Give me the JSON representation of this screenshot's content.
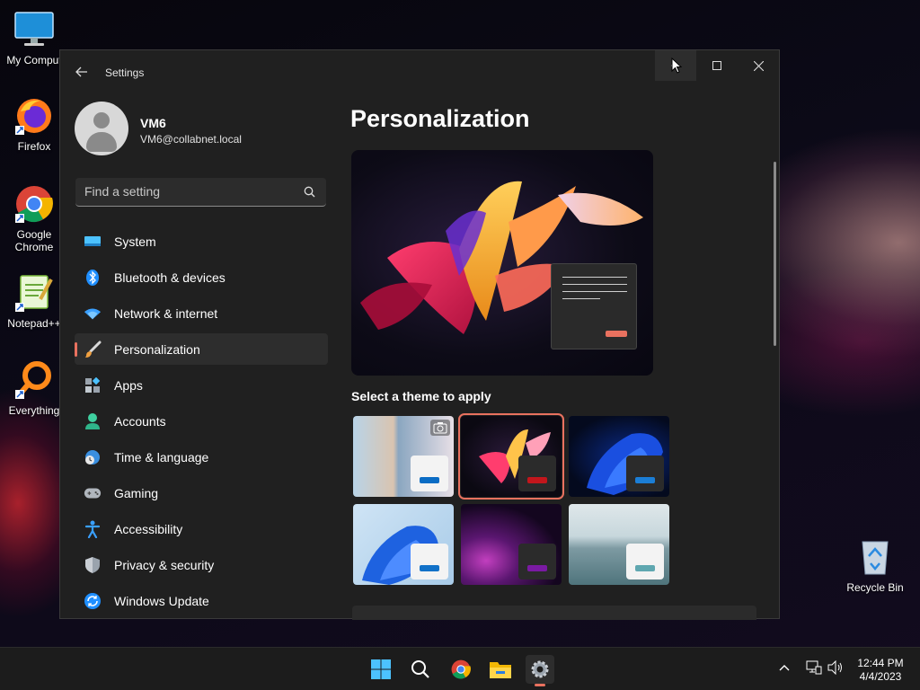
{
  "desktop": {
    "icons": [
      {
        "label": "My Comput",
        "icon": "monitor-icon"
      },
      {
        "label": "Firefox",
        "icon": "firefox-icon"
      },
      {
        "label": "Google Chrome",
        "icon": "chrome-icon"
      },
      {
        "label": "Notepad++",
        "icon": "notepadpp-icon"
      },
      {
        "label": "Everything",
        "icon": "everything-icon"
      },
      {
        "label": "Recycle Bin",
        "icon": "recycle-bin-icon"
      }
    ]
  },
  "window": {
    "title": "Settings",
    "controls": {
      "minimize": "minimize-icon",
      "maximize": "maximize-icon",
      "close": "close-icon"
    }
  },
  "profile": {
    "name": "VM6",
    "email": "VM6@collabnet.local"
  },
  "search": {
    "placeholder": "Find a setting"
  },
  "nav": {
    "items": [
      {
        "label": "System",
        "icon": "system-icon"
      },
      {
        "label": "Bluetooth & devices",
        "icon": "bluetooth-icon"
      },
      {
        "label": "Network & internet",
        "icon": "wifi-icon"
      },
      {
        "label": "Personalization",
        "icon": "brush-icon",
        "active": true
      },
      {
        "label": "Apps",
        "icon": "apps-icon"
      },
      {
        "label": "Accounts",
        "icon": "accounts-icon"
      },
      {
        "label": "Time & language",
        "icon": "clock-globe-icon"
      },
      {
        "label": "Gaming",
        "icon": "gamepad-icon"
      },
      {
        "label": "Accessibility",
        "icon": "accessibility-icon"
      },
      {
        "label": "Privacy & security",
        "icon": "shield-icon"
      },
      {
        "label": "Windows Update",
        "icon": "update-icon"
      }
    ]
  },
  "main": {
    "title": "Personalization",
    "themes_label": "Select a theme to apply",
    "themes": [
      {
        "name": "spotlight",
        "accent": "#0a6cc4",
        "selected": false
      },
      {
        "name": "glow",
        "accent": "#c2161c",
        "selected": true
      },
      {
        "name": "windows-dark",
        "accent": "#1b7ed6",
        "selected": false
      },
      {
        "name": "windows-light",
        "accent": "#1171c8",
        "selected": false
      },
      {
        "name": "captured-motion",
        "accent": "#7a1aa3",
        "selected": false
      },
      {
        "name": "flow",
        "accent": "#5fa7b0",
        "selected": false
      }
    ]
  },
  "taskbar": {
    "icons": [
      "start-icon",
      "search-icon",
      "chrome-icon",
      "file-explorer-icon",
      "settings-icon"
    ],
    "time": "12:44 PM",
    "date": "4/4/2023"
  },
  "colors": {
    "accent": "#e9715f",
    "window_bg": "#202020",
    "selected_nav": "#2d2d2d"
  }
}
